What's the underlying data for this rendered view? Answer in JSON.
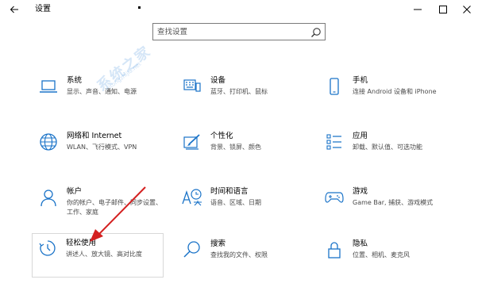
{
  "window": {
    "title": "设置"
  },
  "search": {
    "placeholder": "查找设置"
  },
  "watermark": {
    "text": "系统之家",
    "url": "xitongzhijia.net"
  },
  "tiles": [
    {
      "title": "系统",
      "desc": "显示、声音、通知、电源",
      "icon": "laptop-icon"
    },
    {
      "title": "设备",
      "desc": "蓝牙、打印机、鼠标",
      "icon": "keyboard-printer-icon"
    },
    {
      "title": "手机",
      "desc": "连接 Android 设备和 iPhone",
      "icon": "phone-icon"
    },
    {
      "title": "网络和 Internet",
      "desc": "WLAN、飞行模式、VPN",
      "icon": "globe-icon"
    },
    {
      "title": "个性化",
      "desc": "背景、锁屏、颜色",
      "icon": "paint-brush-icon"
    },
    {
      "title": "应用",
      "desc": "卸载、默认值、可选功能",
      "icon": "apps-list-icon"
    },
    {
      "title": "帐户",
      "desc": "你的帐户、电子邮件、同步设置、工作、家庭",
      "icon": "person-icon"
    },
    {
      "title": "时间和语言",
      "desc": "语音、区域、日期",
      "icon": "time-language-icon"
    },
    {
      "title": "游戏",
      "desc": "Game Bar, 捕获、游戏模式",
      "icon": "gamepad-icon"
    },
    {
      "title": "轻松使用",
      "desc": "讲述人、放大镜、高对比度",
      "icon": "ease-of-access-icon"
    },
    {
      "title": "搜索",
      "desc": "查找我的文件、权限",
      "icon": "search-magnifier-icon"
    },
    {
      "title": "隐私",
      "desc": "位置、相机、麦克风",
      "icon": "lock-icon"
    }
  ],
  "colors": {
    "accent": "#1a73c8",
    "arrow": "#d42020"
  }
}
